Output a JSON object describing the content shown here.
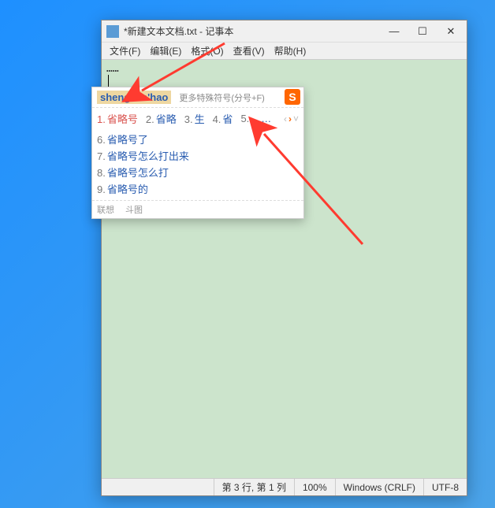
{
  "window": {
    "title": "*新建文本文档.txt - 记事本",
    "menus": {
      "file": "文件(F)",
      "edit": "编辑(E)",
      "format": "格式(O)",
      "view": "查看(V)",
      "help": "帮助(H)"
    },
    "editor_text": "……",
    "statusbar": {
      "position": "第 3 行, 第 1 列",
      "zoom": "100%",
      "eol": "Windows (CRLF)",
      "encoding": "UTF-8"
    },
    "controls": {
      "minimize": "—",
      "maximize": "☐",
      "close": "✕"
    }
  },
  "ime": {
    "input": "sheng'lue'hao",
    "hint": "更多特殊符号(分号+F)",
    "logo": "S",
    "candidates_row": [
      {
        "num": "1.",
        "text": "省略号"
      },
      {
        "num": "2.",
        "text": "省略"
      },
      {
        "num": "3.",
        "text": "生"
      },
      {
        "num": "4.",
        "text": "省"
      },
      {
        "num": "5.",
        "text": "……"
      }
    ],
    "candidates_list": [
      {
        "num": "6.",
        "text": "省略号了"
      },
      {
        "num": "7.",
        "text": "省略号怎么打出来"
      },
      {
        "num": "8.",
        "text": "省略号怎么打"
      },
      {
        "num": "9.",
        "text": "省略号的"
      }
    ],
    "nav": {
      "prev": "‹",
      "next": "›",
      "drop": "˅"
    },
    "footer": {
      "lianxiang": "联想",
      "doutu": "斗图"
    }
  },
  "colors": {
    "desktop": "#1e90ff",
    "editor_bg": "#cce4cc",
    "ime_highlight": "#eed7a1",
    "arrow": "#ff3b30"
  }
}
